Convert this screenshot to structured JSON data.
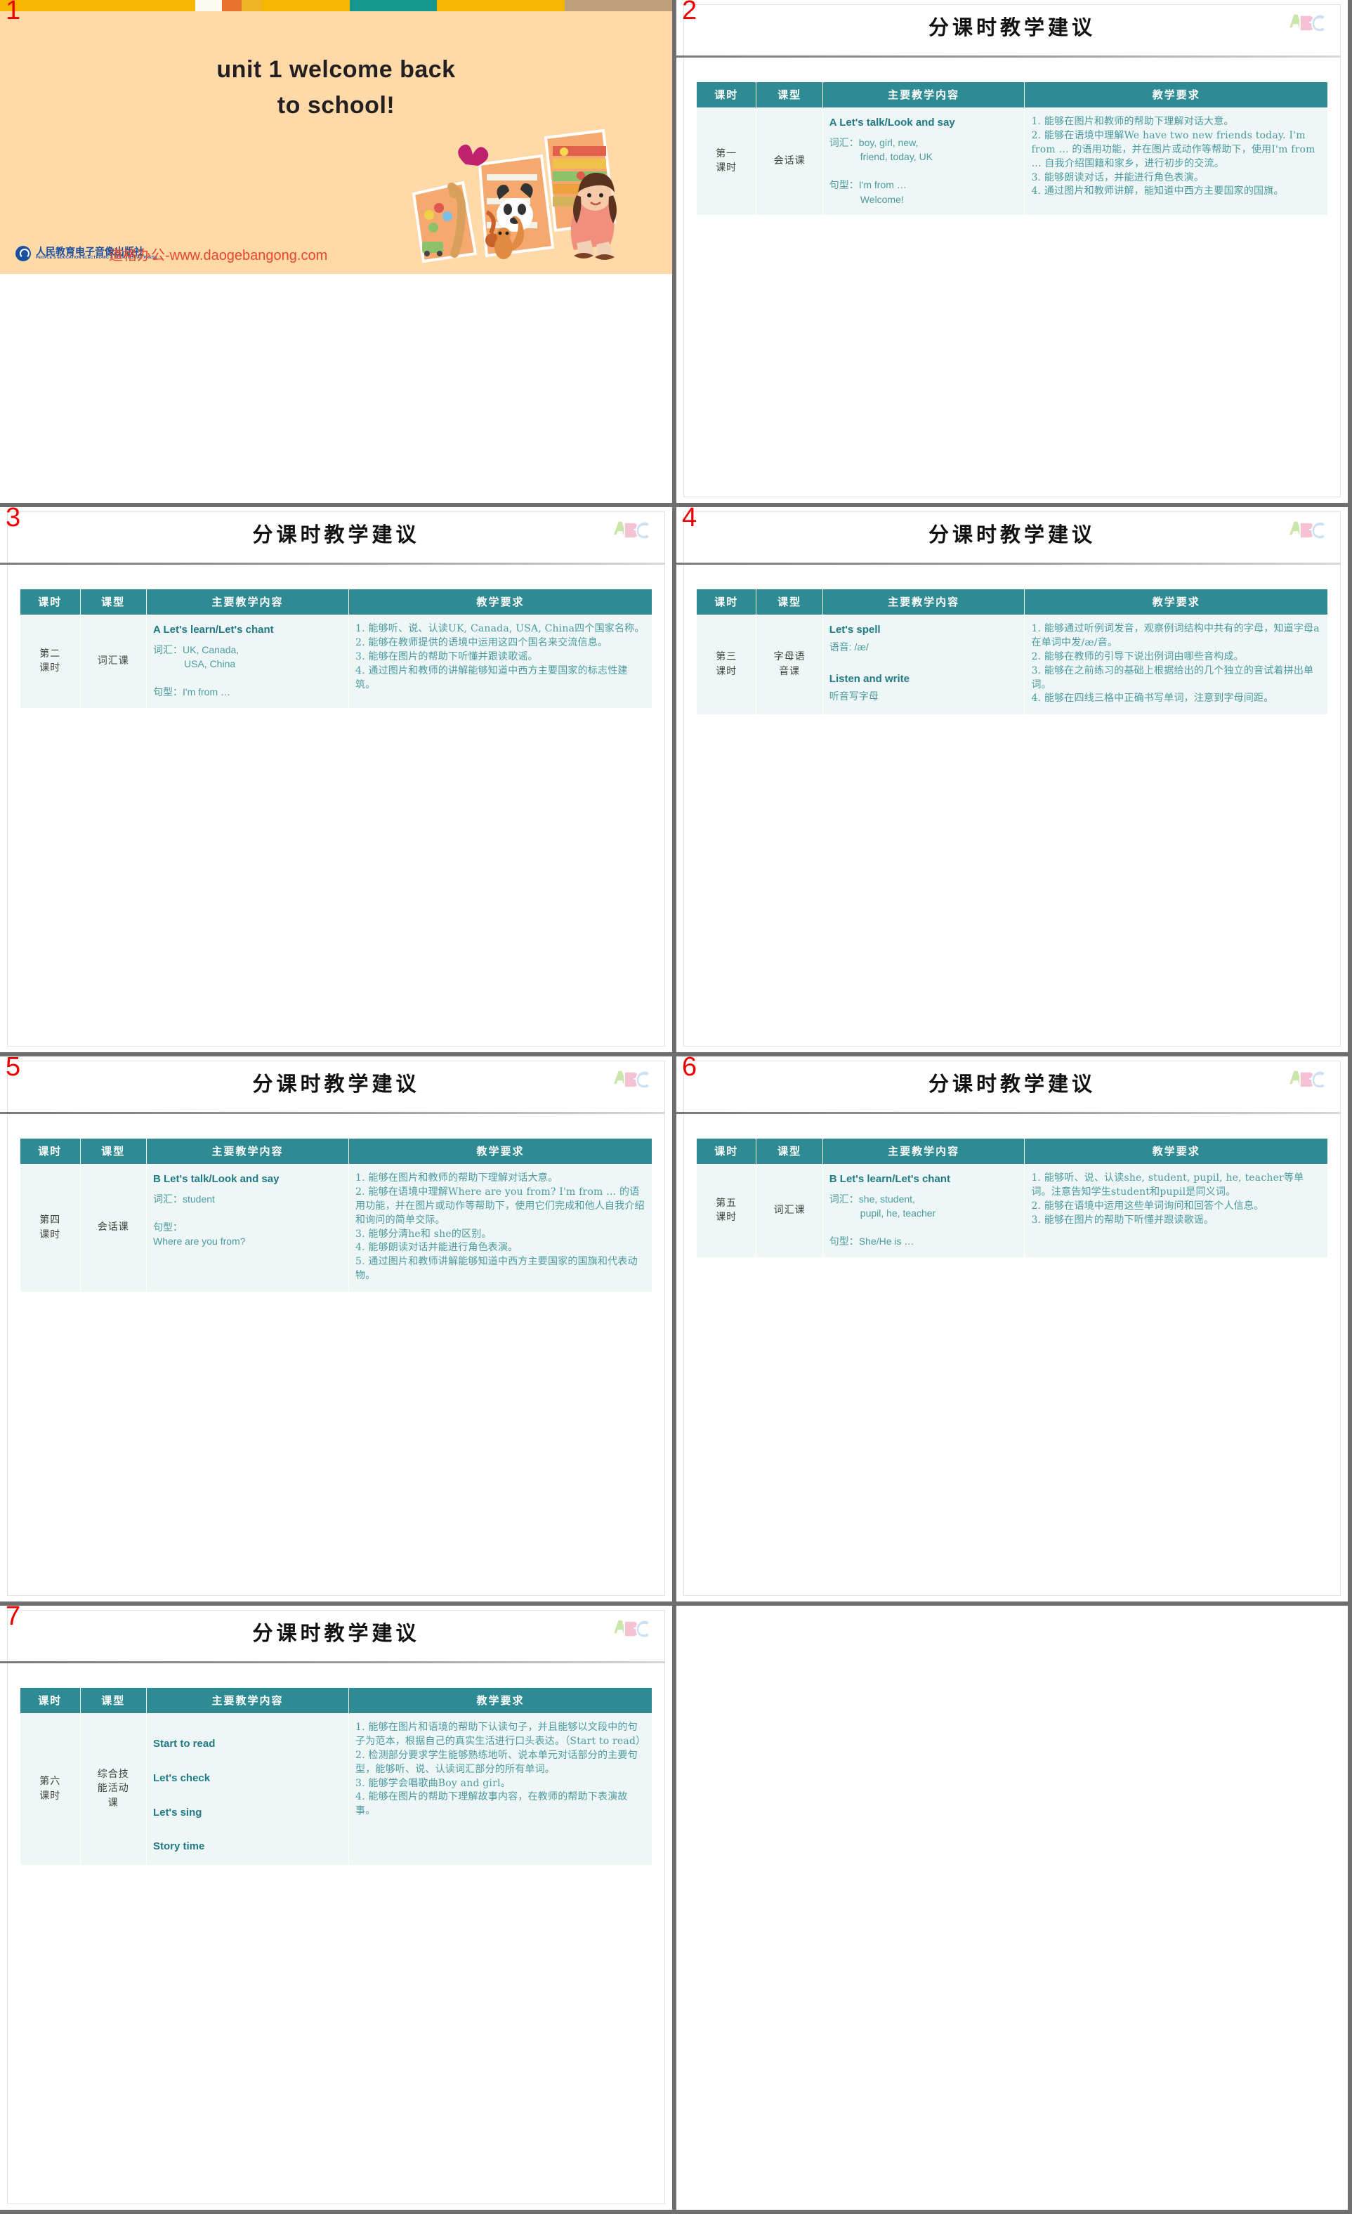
{
  "deck": {
    "slide_numbers": [
      "1",
      "2",
      "3",
      "4",
      "5",
      "6",
      "7"
    ],
    "common_title": "分课时教学建议",
    "table_headers": [
      "课时",
      "课型",
      "主要教学内容",
      "教学要求"
    ],
    "icon_abc": "abc-blocks-icon"
  },
  "slide1": {
    "number": "1",
    "title_line1": "unit 1  welcome back",
    "title_line2": "to school!",
    "publisher_cn": "人民教育电子音像出版社",
    "publisher_en": "PEOPLE'S EDUCATION ELECTRONIC & AUDIOVISUAL PRESS",
    "watermark": "道格办公-www.daogebangong.com",
    "bg_color": "#ffd9a8",
    "topbar_colors": [
      "#f5b500",
      "#fdfaf0",
      "#e8732c",
      "#f0b429",
      "#f5b500",
      "#17968e",
      "#f5b500",
      "#bda077"
    ]
  },
  "slide2": {
    "number": "2",
    "title": "分课时教学建议",
    "row": {
      "period": "第一\n课时",
      "type": "会话课",
      "content_heading": "A Let's talk/Look and say",
      "content_vocab_label": "词汇：",
      "content_vocab_line1": "boy, girl, new,",
      "content_vocab_line2": "friend, today, UK",
      "content_pattern_label": "句型：",
      "content_pattern_line1": "I'm from …",
      "content_pattern_line2": "Welcome!",
      "requirements": [
        "1. 能够在图片和教师的帮助下理解对话大意。",
        "2. 能够在语境中理解We have two new friends today. I'm from … 的语用功能，并在图片或动作等帮助下，使用I'm from … 自我介绍国籍和家乡，进行初步的交流。",
        "3. 能够朗读对话，并能进行角色表演。",
        "4. 通过图片和教师讲解，能知道中西方主要国家的国旗。"
      ]
    }
  },
  "slide3": {
    "number": "3",
    "title": "分课时教学建议",
    "row": {
      "period": "第二\n课时",
      "type": "词汇课",
      "content_heading": "A Let's learn/Let's chant",
      "content_vocab_label": "词汇：",
      "content_vocab_line1": "UK, Canada,",
      "content_vocab_line2": "USA,  China",
      "content_pattern_label": "句型：",
      "content_pattern_line1": "I'm from …",
      "content_pattern_line2": "",
      "requirements": [
        "1. 能够听、说、认读UK, Canada, USA,  China四个国家名称。",
        "2. 能够在教师提供的语境中运用这四个国名来交流信息。",
        "3. 能够在图片的帮助下听懂并跟读歌谣。",
        "4. 通过图片和教师的讲解能够知道中西方主要国家的标志性建筑。"
      ]
    }
  },
  "slide4": {
    "number": "4",
    "title": "分课时教学建议",
    "row": {
      "period": "第三\n课时",
      "type": "字母语\n音课",
      "content_heading": "Let's spell",
      "content_sub1": "语音: /æ/",
      "content_heading2": "Listen and write",
      "content_sub2": "听音写字母",
      "requirements": [
        "1. 能够通过听例词发音，观察例词结构中共有的字母，知道字母a在单词中发/æ/音。",
        "2. 能够在教师的引导下说出例词由哪些音构成。",
        "3. 能够在之前练习的基础上根据给出的几个独立的音试着拼出单词。",
        "4. 能够在四线三格中正确书写单词，注意到字母间距。"
      ]
    }
  },
  "slide5": {
    "number": "5",
    "title": "分课时教学建议",
    "row": {
      "period": "第四\n课时",
      "type": "会话课",
      "content_heading": "B Let's talk/Look and say",
      "content_vocab_label": "词汇：",
      "content_vocab_line1": "student",
      "content_pattern_label": "句型：",
      "content_pattern_line1": "Where are you from?",
      "requirements": [
        "1. 能够在图片和教师的帮助下理解对话大意。",
        "2. 能够在语境中理解Where are you from? I'm from … 的语用功能，并在图片或动作等帮助下，使用它们完成和他人自我介绍和询问的简单交际。",
        "3. 能够分清he和 she的区别。",
        "4. 能够朗读对话并能进行角色表演。",
        "5. 通过图片和教师讲解能够知道中西方主要国家的国旗和代表动物。"
      ]
    }
  },
  "slide6": {
    "number": "6",
    "title": "分课时教学建议",
    "row": {
      "period": "第五\n课时",
      "type": "词汇课",
      "content_heading": "B Let's learn/Let's chant",
      "content_vocab_label": "词汇：",
      "content_vocab_line1": "she, student,",
      "content_vocab_line2": "pupil, he, teacher",
      "content_pattern_label": "句型：",
      "content_pattern_line1": "She/He is …",
      "requirements": [
        "1. 能够听、说、认读she, student, pupil, he, teacher等单词。注意告知学生student和pupil是同义词。",
        "2. 能够在语境中运用这些单词询问和回答个人信息。",
        "3. 能够在图片的帮助下听懂并跟读歌谣。"
      ]
    }
  },
  "slide7": {
    "number": "7",
    "title": "分课时教学建议",
    "row": {
      "period": "第六\n课时",
      "type": "综合技\n能活动\n课",
      "content_items": [
        "Start to read",
        "Let's check",
        "Let's sing",
        "Story time"
      ],
      "requirements": [
        "1. 能够在图片和语境的帮助下认读句子，并且能够以文段中的句子为范本，根据自己的真实生活进行口头表达。（Start to read）",
        "2. 检测部分要求学生能够熟练地听、说本单元对话部分的主要句型，能够听、说、认读词汇部分的所有单词。",
        "3. 能够学会唱歌曲Boy and girl。",
        "4. 能够在图片的帮助下理解故事内容，在教师的帮助下表演故事。"
      ]
    }
  },
  "colors": {
    "header_teal": "#2e8b93",
    "cell_mint": "#eef7f6",
    "body_teal": "#4b9aa0",
    "heading_teal": "#1f7a86",
    "slide_number_red": "#ee0000",
    "title_bg_peach": "#ffd9a8"
  }
}
